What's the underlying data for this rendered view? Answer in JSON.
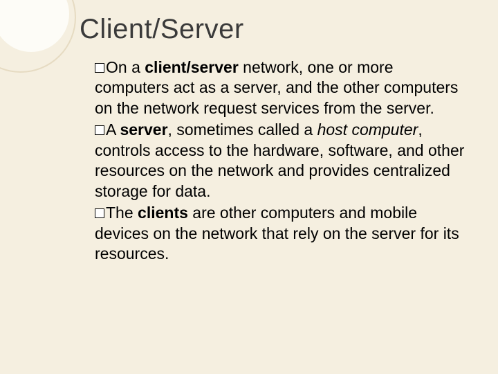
{
  "slide": {
    "title": "Client/Server",
    "bullets": [
      {
        "pre": "On a ",
        "bold1": "client/server",
        "mid1": " network, one or more computers act as a server, and the other computers on the network request services from the server.",
        "bold2": "",
        "italic": "",
        "post": ""
      },
      {
        "pre": "A ",
        "bold1": "server",
        "mid1": ", sometimes called a ",
        "italic": "host computer",
        "mid2": ", controls access to the hardware, software, and other resources on the network and provides centralized storage for data.",
        "bold2": "",
        "post": ""
      },
      {
        "pre": "The ",
        "bold1": "clients",
        "mid1": " are other computers and mobile devices on the network that rely on the server for its resources.",
        "bold2": "",
        "italic": "",
        "post": ""
      }
    ]
  }
}
